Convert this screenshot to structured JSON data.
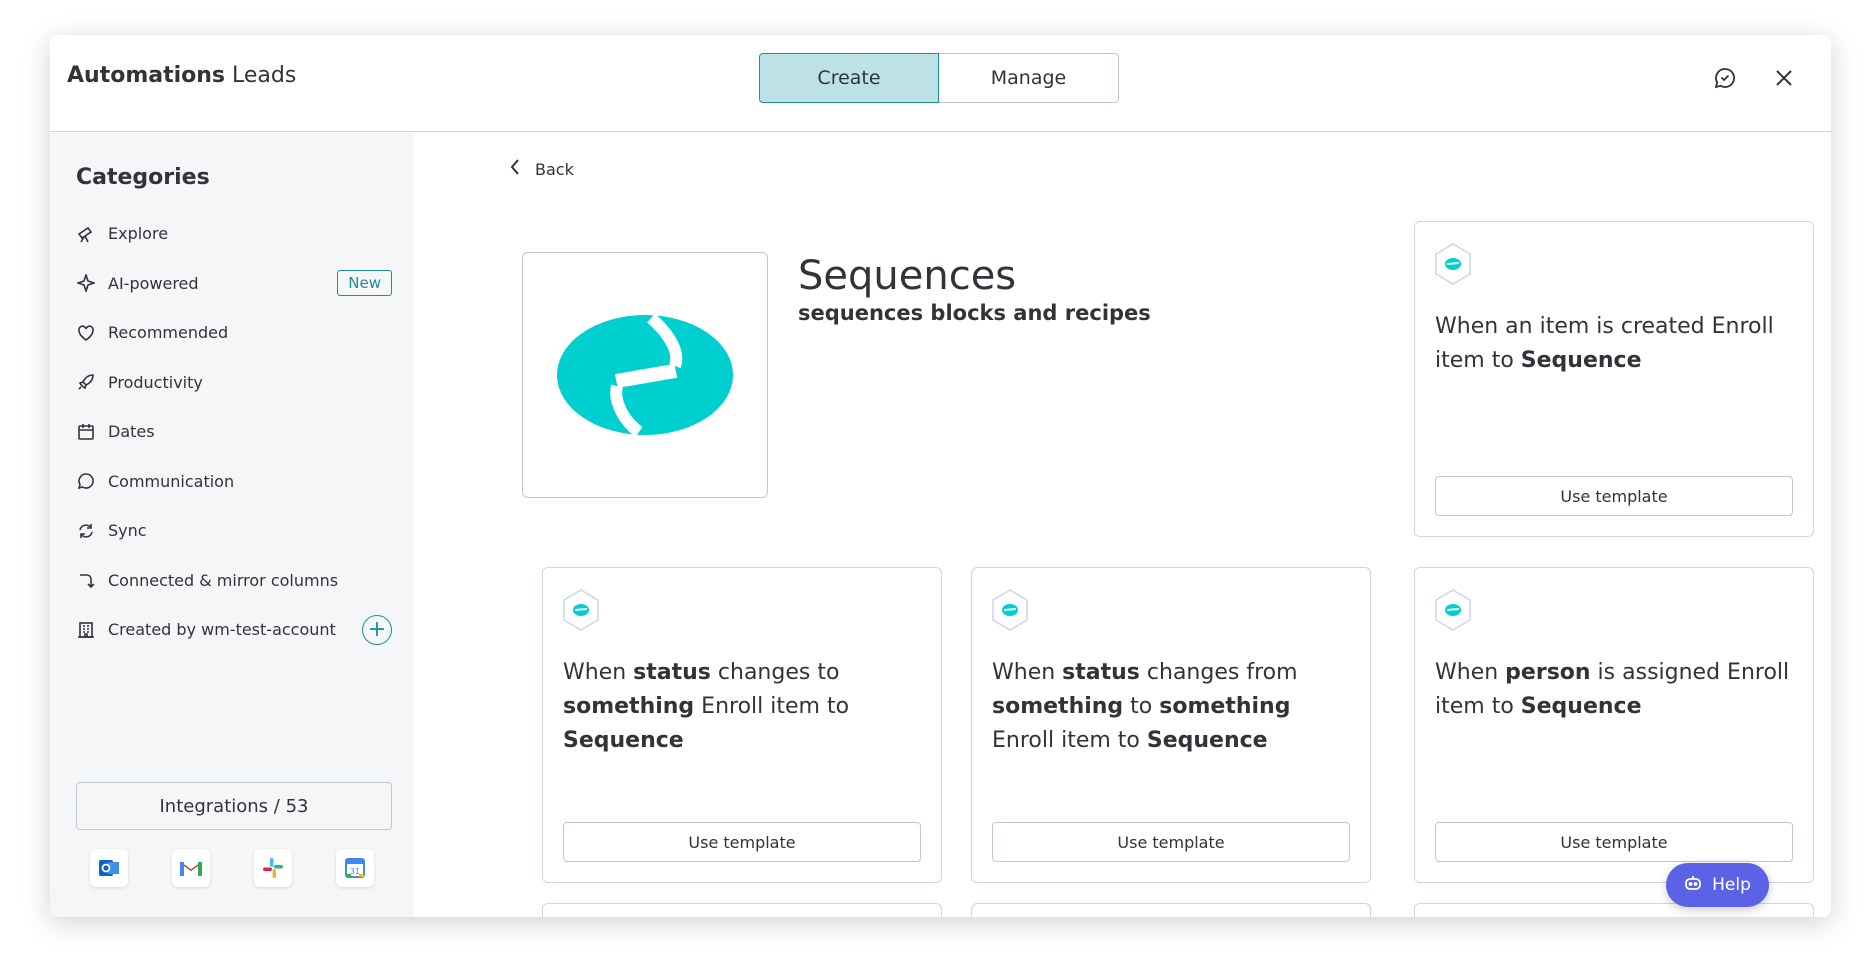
{
  "header": {
    "title_bold": "Automations",
    "title_rest": " Leads",
    "tabs": [
      {
        "label": "Create"
      },
      {
        "label": "Manage"
      }
    ],
    "active_tab": "Create"
  },
  "sidebar": {
    "title": "Categories",
    "items": [
      {
        "label": "Explore",
        "icon": "telescope-icon"
      },
      {
        "label": "AI-powered",
        "icon": "sparkle-icon",
        "badge": "New"
      },
      {
        "label": "Recommended",
        "icon": "heart-icon"
      },
      {
        "label": "Productivity",
        "icon": "rocket-icon"
      },
      {
        "label": "Dates",
        "icon": "calendar-icon"
      },
      {
        "label": "Communication",
        "icon": "chat-bubble-icon"
      },
      {
        "label": "Sync",
        "icon": "sync-icon"
      },
      {
        "label": "Connected & mirror columns",
        "icon": "connect-arrow-icon"
      },
      {
        "label": "Created by wm-test-account",
        "icon": "building-icon"
      }
    ],
    "integrations_label": "Integrations / 53",
    "integration_icons": [
      "outlook-icon",
      "gmail-icon",
      "slack-icon",
      "google-calendar-icon"
    ]
  },
  "main": {
    "back_label": "Back",
    "hero": {
      "title": "Sequences",
      "subtitle": "sequences blocks and recipes"
    },
    "use_template_label": "Use template",
    "cards": [
      {
        "parts": [
          {
            "t": "When an item is created Enroll item to ",
            "b": false
          },
          {
            "t": "Sequence",
            "b": true
          }
        ]
      },
      {
        "parts": [
          {
            "t": "When ",
            "b": false
          },
          {
            "t": "status",
            "b": true
          },
          {
            "t": " changes to ",
            "b": false
          },
          {
            "t": "something",
            "b": true
          },
          {
            "t": " Enroll item to ",
            "b": false
          },
          {
            "t": "Sequence",
            "b": true
          }
        ]
      },
      {
        "parts": [
          {
            "t": "When ",
            "b": false
          },
          {
            "t": "status",
            "b": true
          },
          {
            "t": " changes from ",
            "b": false
          },
          {
            "t": "something",
            "b": true
          },
          {
            "t": " to ",
            "b": false
          },
          {
            "t": "something",
            "b": true
          },
          {
            "t": " Enroll item to ",
            "b": false
          },
          {
            "t": "Sequence",
            "b": true
          }
        ]
      },
      {
        "parts": [
          {
            "t": "When ",
            "b": false
          },
          {
            "t": "person",
            "b": true
          },
          {
            "t": " is assigned Enroll item to ",
            "b": false
          },
          {
            "t": "Sequence",
            "b": true
          }
        ]
      }
    ]
  },
  "help_label": "Help",
  "colors": {
    "accent": "#1f8d9c",
    "brand_teal": "#00cfcf",
    "help_bg": "#5b62e6"
  }
}
